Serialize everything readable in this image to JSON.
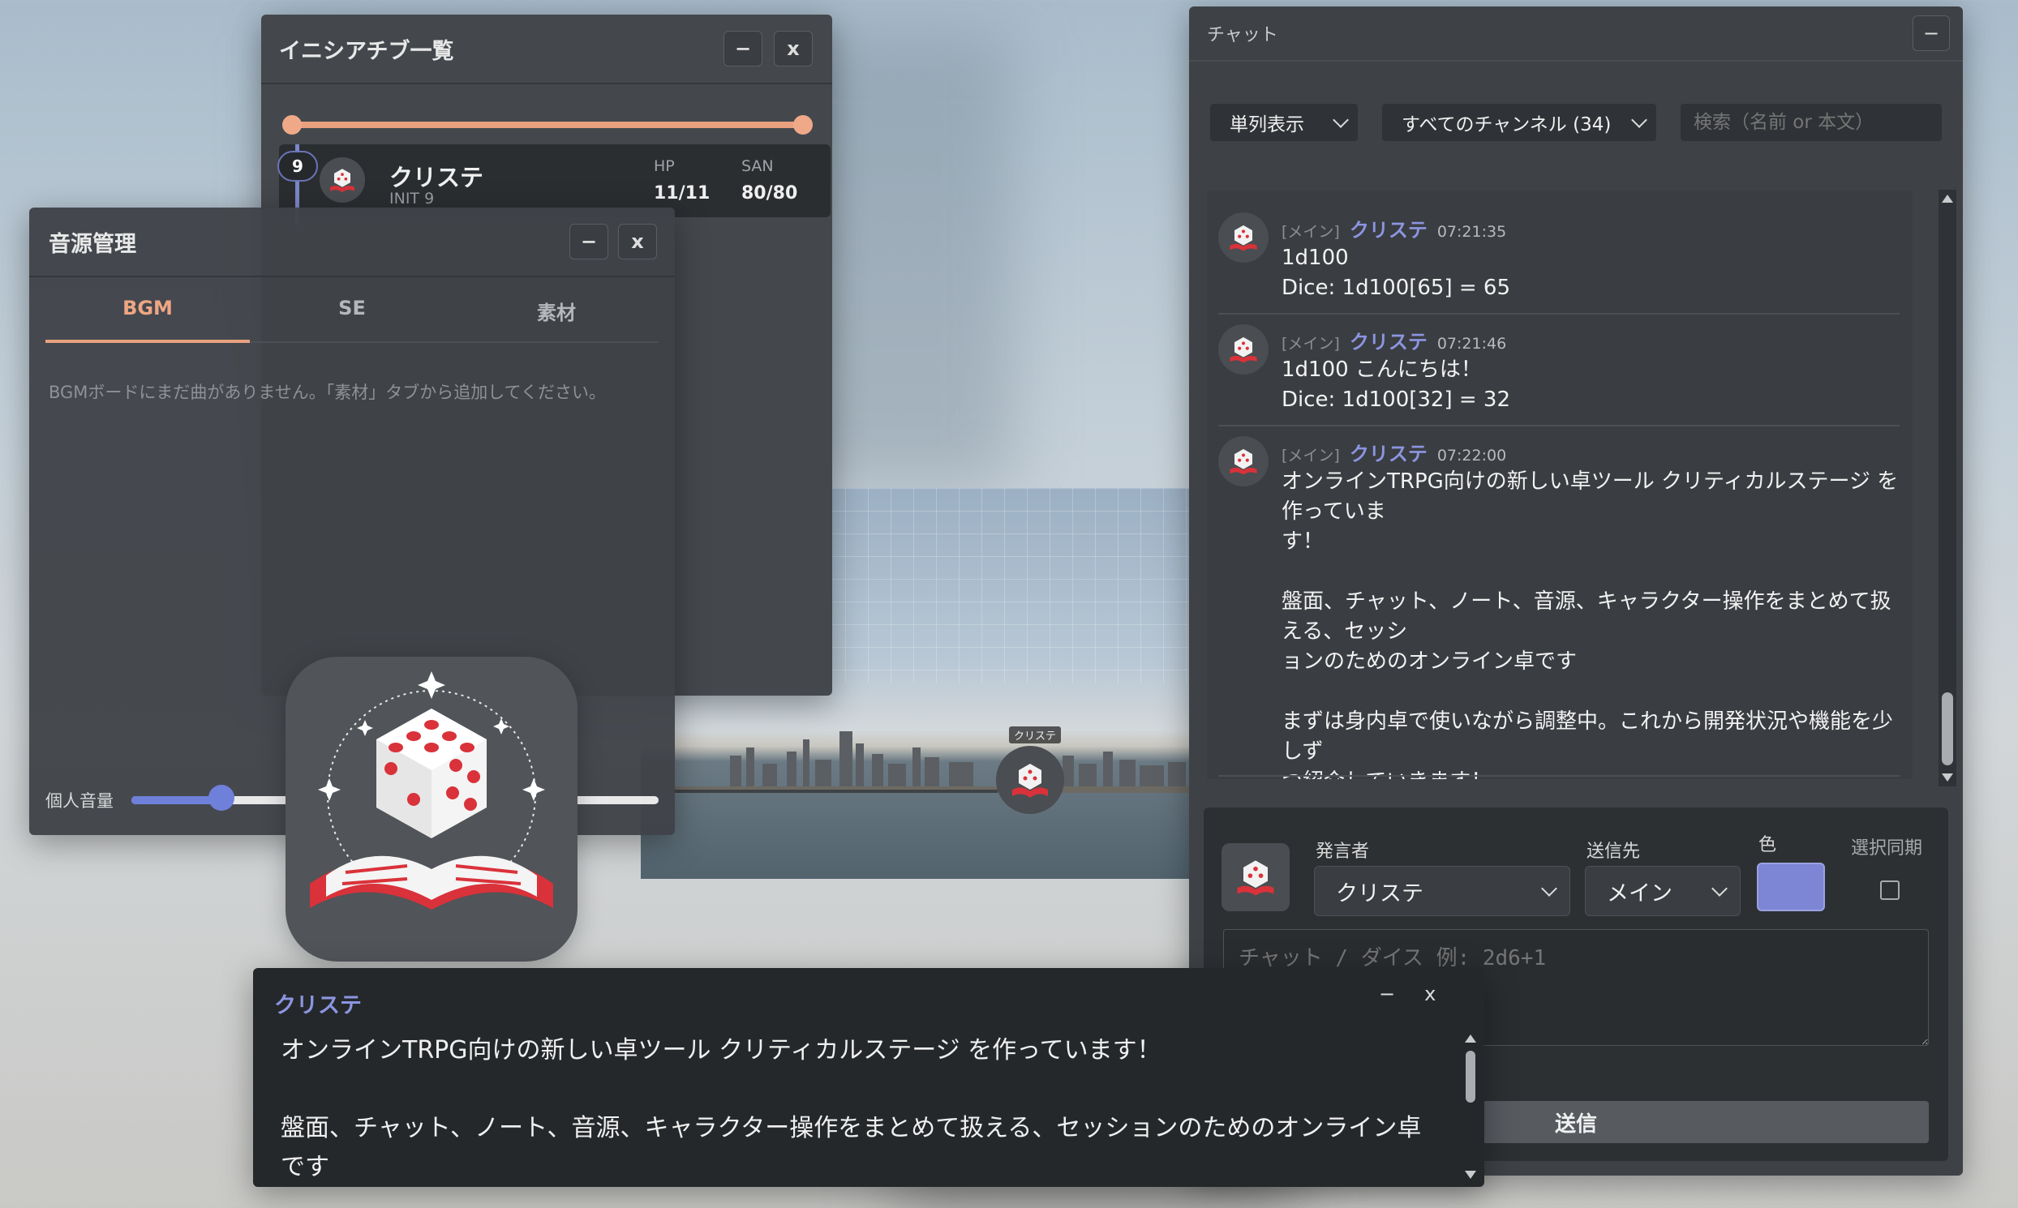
{
  "initiative_window": {
    "title": "イニシアチブ一覧",
    "minimize": "−",
    "close": "x",
    "entry": {
      "order": "9",
      "name": "クリステ",
      "init": "INIT 9",
      "hp_label": "HP",
      "hp_value": "11/11",
      "san_label": "SAN",
      "san_value": "80/80"
    }
  },
  "audio_window": {
    "title": "音源管理",
    "minimize": "−",
    "close": "x",
    "tabs": [
      "BGM",
      "SE",
      "素材"
    ],
    "active_tab": "BGM",
    "empty_message": "BGMボードにまだ曲がありません。「素材」タブから追加してください。",
    "volume_label": "個人音量",
    "volume_fraction": 0.17
  },
  "map": {
    "token_label": "クリステ"
  },
  "chat_window": {
    "title": "チャット",
    "minimize": "−",
    "view_select": "単列表示",
    "channel_select": "すべてのチャンネル (34)",
    "search_placeholder": "検索（名前 or 本文）",
    "messages": [
      {
        "channel": "[メイン]",
        "name": "クリステ",
        "time": "07:21:35",
        "body": "1d100\nDice: 1d100[65] = 65"
      },
      {
        "channel": "[メイン]",
        "name": "クリステ",
        "time": "07:21:46",
        "body": "1d100 こんにちは！\nDice: 1d100[32] = 32"
      },
      {
        "channel": "[メイン]",
        "name": "クリステ",
        "time": "07:22:00",
        "body": "オンラインTRPG向けの新しい卓ツール クリティカルステージ を作っていま\nす！\n\n盤面、チャット、ノート、音源、キャラクター操作をまとめて扱える、セッシ\nョンのためのオンライン卓です\n\nまずは身内卓で使いながら調整中。これから開発状況や機能を少しず\nつ紹介していきます！\n\nクリステの愛称で覚えてください！"
      }
    ],
    "compose": {
      "speaker_label": "発言者",
      "speaker_value": "クリステ",
      "target_label": "送信先",
      "target_value": "メイン",
      "color_label": "色",
      "color_value": "#7c86d4",
      "sync_label": "選択同期",
      "input_placeholder": "チャット / ダイス 例: 2d6+1",
      "send_label": "送信"
    }
  },
  "popup": {
    "name": "クリステ",
    "minimize": "−",
    "close": "x",
    "body": "オンラインTRPG向けの新しい卓ツール クリティカルステージ を作っています！\n\n盤面、チャット、ノート、音源、キャラクター操作をまとめて扱える、セッションのためのオンライン卓です"
  },
  "colors": {
    "accent_orange": "#e9a07f",
    "accent_blue": "#6f80db",
    "name_purple": "#8c95e0"
  }
}
